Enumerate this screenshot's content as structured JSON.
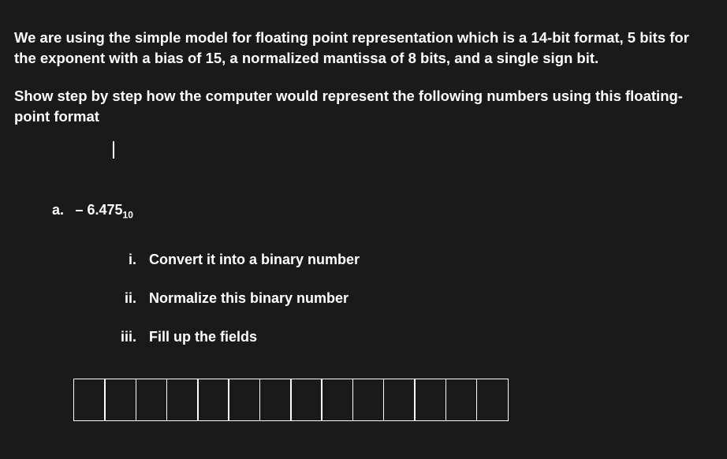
{
  "intro": "We are using the simple model for floating point representation which is a 14-bit format, 5 bits for the exponent with a bias of 15, a normalized mantissa of 8 bits, and a single sign bit.",
  "instruction": "Show step by step how the computer would represent the following numbers using this floating-point format",
  "question": {
    "label": "a.",
    "valuePrefix": "– 6.475",
    "valueSubscript": "10"
  },
  "subitems": [
    {
      "marker": "i.",
      "text": "Convert it into a binary number"
    },
    {
      "marker": "ii.",
      "text": "Normalize this binary number"
    },
    {
      "marker": "iii.",
      "text": "Fill up the fields"
    }
  ],
  "bitCount": 14
}
